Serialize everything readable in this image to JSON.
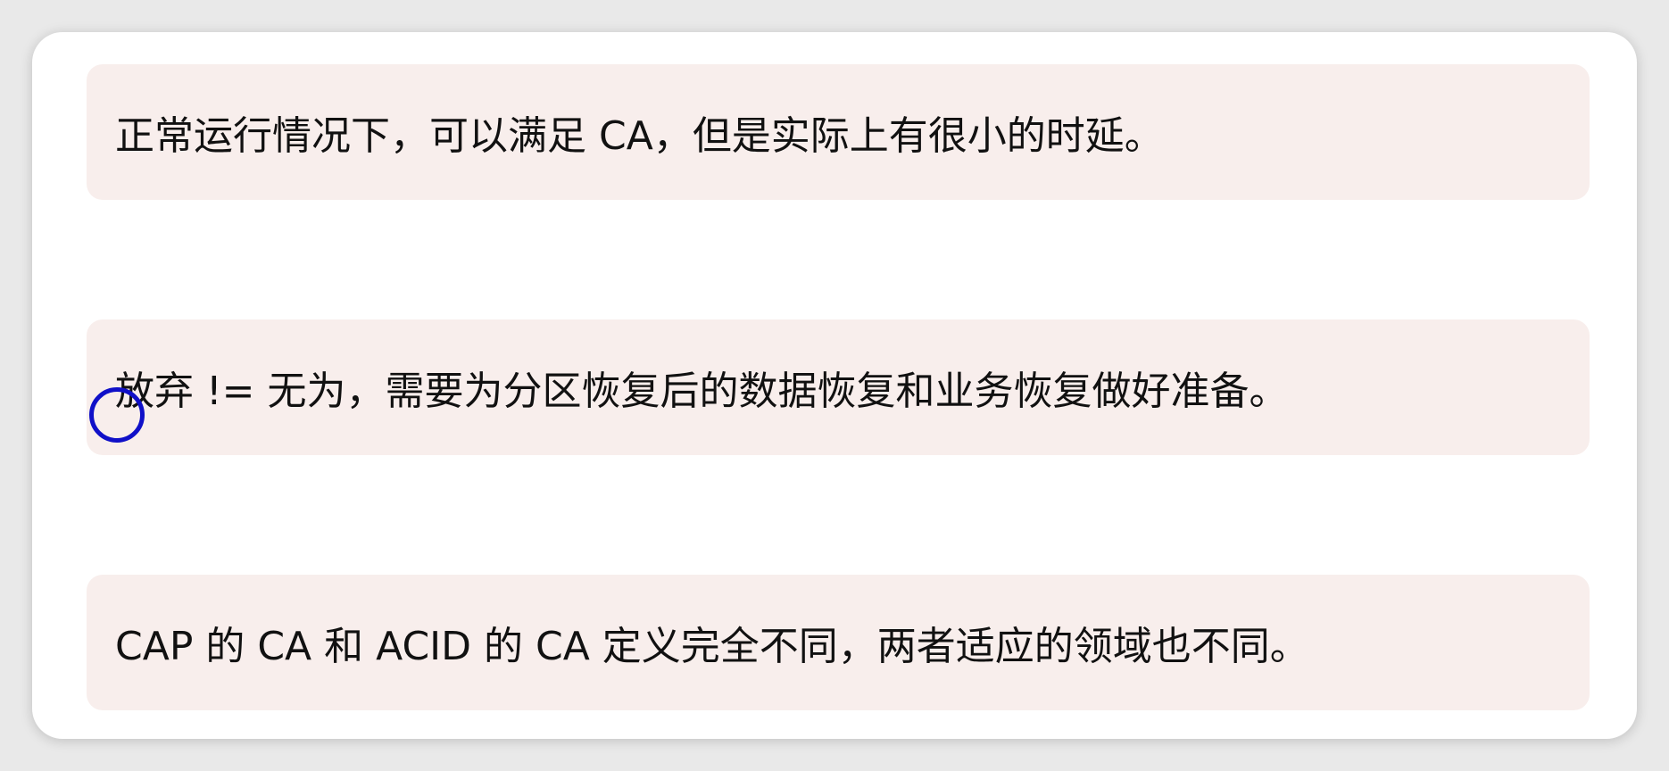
{
  "notes": [
    {
      "text": "正常运行情况下，可以满足 CA，但是实际上有很小的时延。"
    },
    {
      "text": "放弃 != 无为，需要为分区恢复后的数据恢复和业务恢复做好准备。"
    },
    {
      "text": "CAP 的 CA 和 ACID 的 CA 定义完全不同，两者适应的领域也不同。"
    }
  ],
  "colors": {
    "note_background": "#f8eeec",
    "cursor_ring": "#1010c8",
    "text": "#111111"
  },
  "icons": {
    "cursor": "cursor-ring-icon"
  }
}
